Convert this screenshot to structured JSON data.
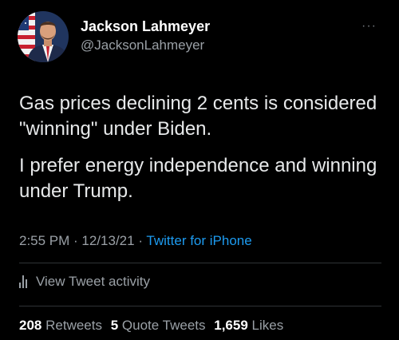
{
  "author": {
    "display_name": "Jackson Lahmeyer",
    "handle": "@JacksonLahmeyer"
  },
  "menu_icon": "more-dots-icon",
  "tweet": {
    "paragraphs": [
      "Gas prices declining 2 cents is considered \"winning\" under Biden.",
      "I prefer energy independence and winning under Trump."
    ]
  },
  "meta": {
    "time": "2:55 PM",
    "separator1": " · ",
    "date": "12/13/21",
    "separator2": " · ",
    "source": "Twitter for iPhone"
  },
  "activity": {
    "icon": "analytics-bars-icon",
    "label": "View Tweet activity"
  },
  "stats": {
    "retweets_count": "208",
    "retweets_label": "Retweets",
    "quotes_count": "5",
    "quotes_label": "Quote Tweets",
    "likes_count": "1,659",
    "likes_label": "Likes"
  },
  "colors": {
    "background": "#000000",
    "text": "#e7e9ea",
    "muted": "#9aa0a6",
    "link": "#1d9bf0",
    "divider": "#2f3336"
  }
}
